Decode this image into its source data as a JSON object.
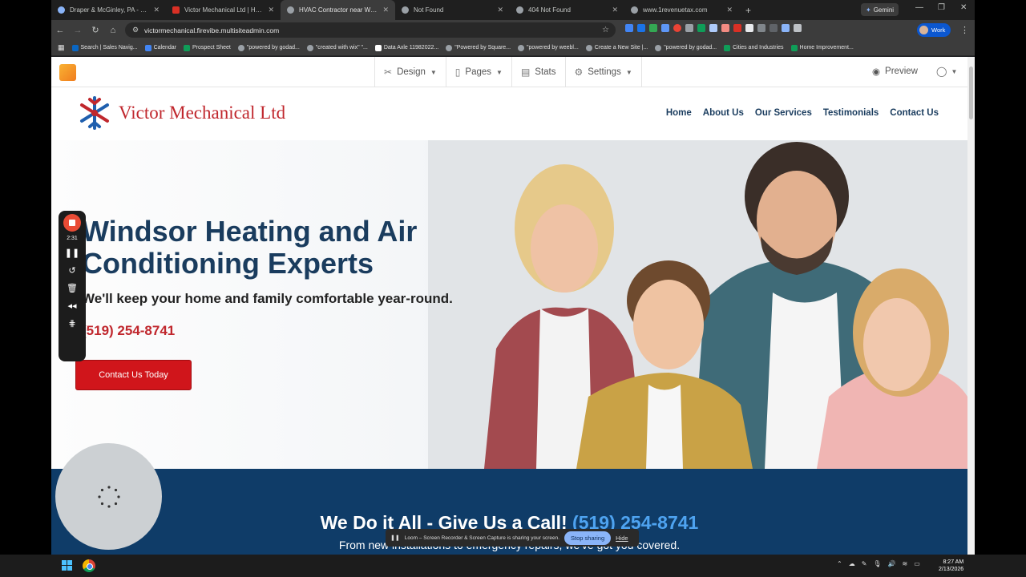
{
  "browser": {
    "tabs": [
      {
        "title": "Draper & McGinley, PA - Home",
        "icon": "google-icon",
        "color": "#8ab4f8"
      },
      {
        "title": "Victor Mechanical Ltd | HVAC",
        "icon": "site-favicon",
        "color": "#d93025"
      },
      {
        "title": "HVAC Contractor near Windsor",
        "icon": "globe-icon",
        "color": "#9aa0a6"
      },
      {
        "title": "Not Found",
        "icon": "globe-icon",
        "color": "#9aa0a6"
      },
      {
        "title": "404 Not Found",
        "icon": "globe-icon",
        "color": "#9aa0a6"
      },
      {
        "title": "www.1revenuetax.com",
        "icon": "globe-icon",
        "color": "#9aa0a6"
      }
    ],
    "active_tab": 2,
    "new_tab_label": "+",
    "gemini_label": "Gemini",
    "url": "victormechanical.firevibe.multisiteadmin.com",
    "profile_label": "Work",
    "bookmarks": [
      {
        "label": "Search | Sales Navig...",
        "color": "#0a66c2"
      },
      {
        "label": "Calendar",
        "color": "#4285f4"
      },
      {
        "label": "Prospect Sheet",
        "color": "#0f9d58"
      },
      {
        "label": "\"powered by godad...",
        "color": "#9aa0a6"
      },
      {
        "label": "\"created with wix\" \"...",
        "color": "#9aa0a6"
      },
      {
        "label": "Data Axle 11982022...",
        "color": "#ffffff"
      },
      {
        "label": "\"Powered by Square...",
        "color": "#9aa0a6"
      },
      {
        "label": "\"powered by weebl...",
        "color": "#9aa0a6"
      },
      {
        "label": "Create a New Site |...",
        "color": "#9aa0a6"
      },
      {
        "label": "\"powered by godad...",
        "color": "#9aa0a6"
      },
      {
        "label": "Cities and Industries",
        "color": "#0f9d58"
      },
      {
        "label": "Home Improvement...",
        "color": "#0f9d58"
      }
    ]
  },
  "editor": {
    "menu": [
      {
        "label": "Design",
        "icon": "design-icon"
      },
      {
        "label": "Pages",
        "icon": "page-icon"
      },
      {
        "label": "Stats",
        "icon": "stats-icon"
      },
      {
        "label": "Settings",
        "icon": "gear-icon"
      }
    ],
    "preview_label": "Preview"
  },
  "site": {
    "name": "Victor Mechanical Ltd",
    "nav": [
      "Home",
      "About Us",
      "Our Services",
      "Testimonials",
      "Contact Us"
    ],
    "hero_title_line1": "Windsor Heating and Air",
    "hero_title_line2": "Conditioning Experts",
    "hero_subtitle": "We'll keep your home and family comfortable year-round.",
    "hero_phone": "(519) 254-8741",
    "hero_button": "Contact Us Today",
    "band_title": "We Do it All - Give Us a Call!",
    "band_phone": "(519) 254-8741",
    "band_sub": "From new installations to emergency repairs, we've got you covered."
  },
  "loom": {
    "timer": "2:31",
    "share_text": "Loom – Screen Recorder & Screen Capture is sharing your screen.",
    "stop_label": "Stop sharing",
    "hide_label": "Hide"
  },
  "taskbar": {
    "time": "8:27 AM",
    "date": "2/13/2026"
  },
  "colors": {
    "brand_red": "#c0272d",
    "brand_navy": "#1a3c5e",
    "band_blue": "#0f3c68",
    "band_phone": "#4ea3f0",
    "cta_red": "#d0151b"
  }
}
